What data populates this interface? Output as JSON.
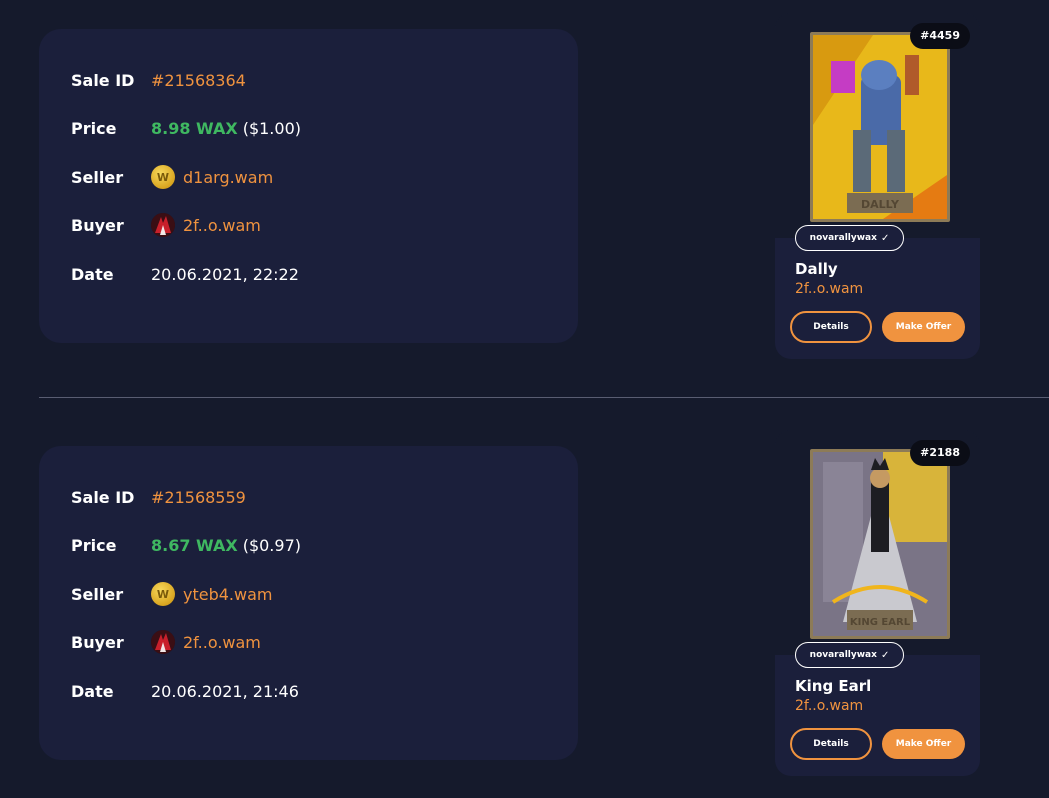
{
  "labels": {
    "sale_id": "Sale ID",
    "price": "Price",
    "seller": "Seller",
    "buyer": "Buyer",
    "date": "Date",
    "details_button": "Details",
    "offer_button": "Make Offer"
  },
  "sales": [
    {
      "sale_id": "#21568364",
      "price_wax": "8.98 WAX",
      "price_usd": "($1.00)",
      "seller": "d1arg.wam",
      "buyer": "2f..o.wam",
      "date": "20.06.2021, 22:22",
      "nft": {
        "mint": "#4459",
        "collection": "novarallywax",
        "name": "Dally",
        "owner": "2f..o.wam",
        "art_caption": "DALLY"
      }
    },
    {
      "sale_id": "#21568559",
      "price_wax": "8.67 WAX",
      "price_usd": "($0.97)",
      "seller": "yteb4.wam",
      "buyer": "2f..o.wam",
      "date": "20.06.2021, 21:46",
      "nft": {
        "mint": "#2188",
        "collection": "novarallywax",
        "name": "King Earl",
        "owner": "2f..o.wam",
        "art_caption": "KING EARL"
      }
    }
  ],
  "colors": {
    "accent": "#f0933f",
    "price_green": "#3fb861",
    "card_bg": "#1b1f3b",
    "page_bg": "#151a2c"
  },
  "icons": {
    "seller_avatar": "wax-coin-icon",
    "buyer_avatar": "buyer-avatar-icon",
    "verified": "check-icon"
  }
}
